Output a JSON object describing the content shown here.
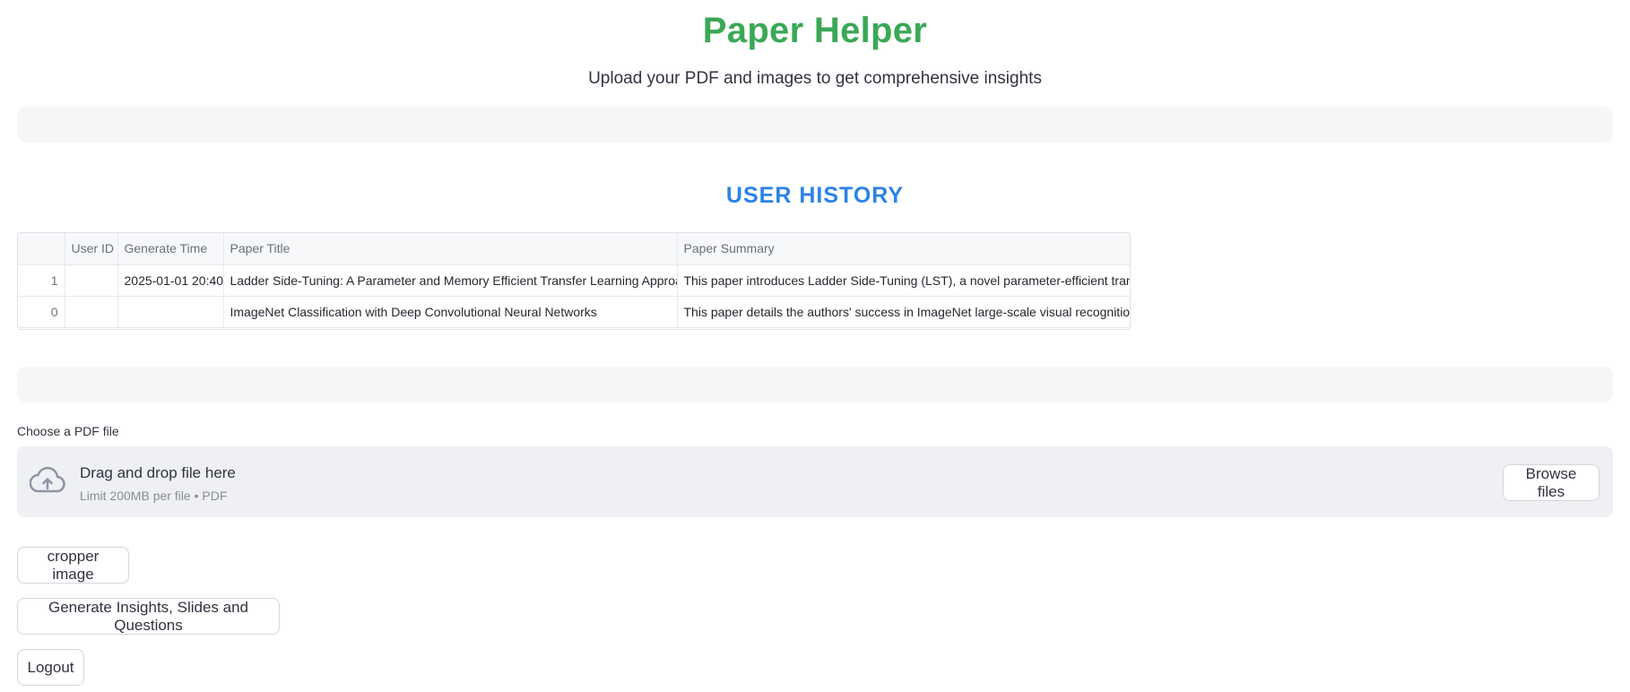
{
  "header": {
    "title": "Paper Helper",
    "subtitle": "Upload your PDF and images to get comprehensive insights"
  },
  "history": {
    "heading": "USER HISTORY",
    "columns": [
      "",
      "User ID",
      "Generate Time",
      "Paper Title",
      "Paper Summary"
    ],
    "rows": [
      {
        "index": "1",
        "user_id": "",
        "generate_time": "2025-01-01 20:40",
        "paper_title": "Ladder Side-Tuning: A Parameter and Memory Efficient Transfer Learning Approach",
        "paper_summary": "This paper introduces Ladder Side-Tuning (LST), a novel parameter-efficient transfer"
      },
      {
        "index": "0",
        "user_id": "",
        "generate_time": "",
        "paper_title": "ImageNet Classification with Deep Convolutional Neural Networks",
        "paper_summary": "This paper details the authors' success in ImageNet large-scale visual recognition cha"
      }
    ]
  },
  "upload": {
    "label": "Choose a PDF file",
    "drop_title": "Drag and drop file here",
    "limit_text": "Limit 200MB per file • PDF",
    "browse_label": "Browse files",
    "icon": "cloud-upload-icon"
  },
  "actions": {
    "cropper_label": "cropper image",
    "generate_label": "Generate Insights, Slides and Questions",
    "logout_label": "Logout"
  },
  "colors": {
    "title": "#3aa856",
    "heading": "#2c83e6"
  }
}
